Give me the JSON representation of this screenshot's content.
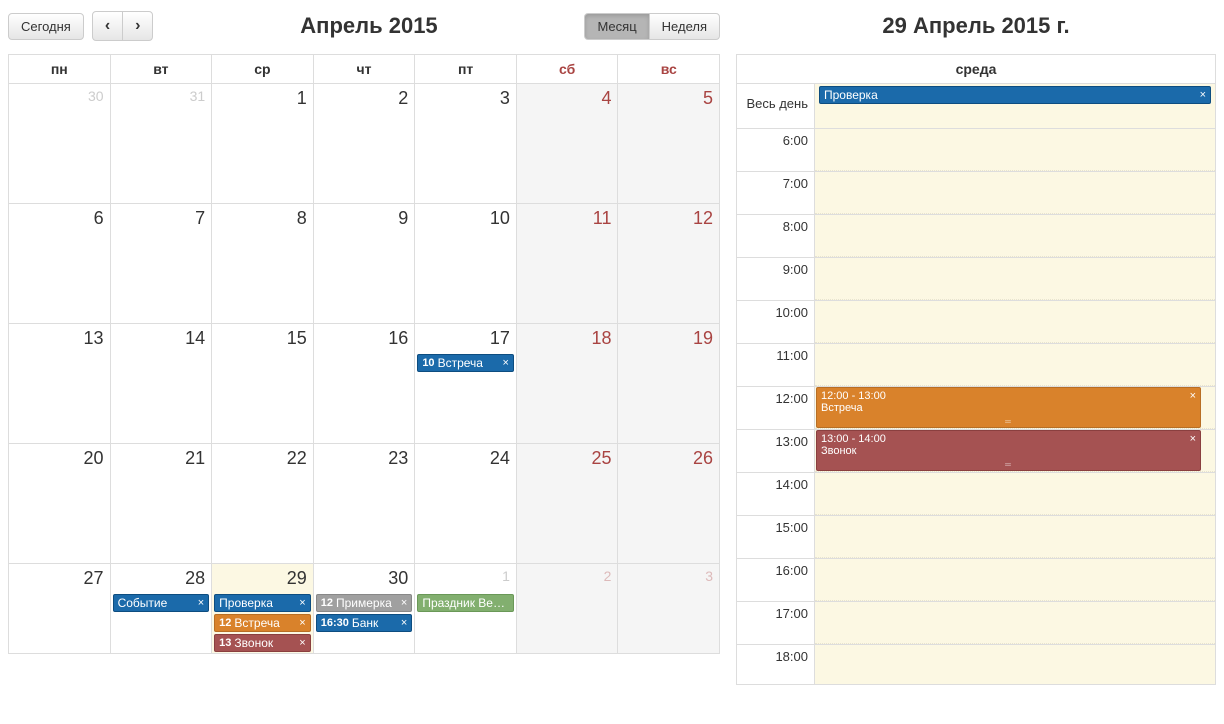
{
  "toolbar": {
    "today": "Сегодня",
    "prev_icon": "‹",
    "next_icon": "›",
    "title": "Апрель 2015",
    "view_month": "Месяц",
    "view_week": "Неделя",
    "active_view": "month"
  },
  "dow": [
    "пн",
    "вт",
    "ср",
    "чт",
    "пт",
    "сб",
    "вс"
  ],
  "weeks": [
    [
      {
        "num": "30",
        "other": true
      },
      {
        "num": "31",
        "other": true
      },
      {
        "num": "1"
      },
      {
        "num": "2"
      },
      {
        "num": "3"
      },
      {
        "num": "4",
        "weekend": true
      },
      {
        "num": "5",
        "weekend": true
      }
    ],
    [
      {
        "num": "6"
      },
      {
        "num": "7"
      },
      {
        "num": "8"
      },
      {
        "num": "9"
      },
      {
        "num": "10"
      },
      {
        "num": "11",
        "weekend": true
      },
      {
        "num": "12",
        "weekend": true
      }
    ],
    [
      {
        "num": "13"
      },
      {
        "num": "14"
      },
      {
        "num": "15"
      },
      {
        "num": "16"
      },
      {
        "num": "17",
        "events": [
          {
            "time": "10",
            "title": "Встреча",
            "cls": "blue"
          }
        ]
      },
      {
        "num": "18",
        "weekend": true
      },
      {
        "num": "19",
        "weekend": true
      }
    ],
    [
      {
        "num": "20"
      },
      {
        "num": "21"
      },
      {
        "num": "22"
      },
      {
        "num": "23"
      },
      {
        "num": "24"
      },
      {
        "num": "25",
        "weekend": true
      },
      {
        "num": "26",
        "weekend": true
      }
    ],
    [
      {
        "num": "27"
      },
      {
        "num": "28",
        "events": [
          {
            "time": "",
            "title": "Событие",
            "cls": "blue"
          }
        ]
      },
      {
        "num": "29",
        "selected": true,
        "events": [
          {
            "time": "",
            "title": "Проверка",
            "cls": "blue"
          },
          {
            "time": "12",
            "title": "Встреча",
            "cls": "orange"
          },
          {
            "time": "13",
            "title": "Звонок",
            "cls": "brown"
          }
        ]
      },
      {
        "num": "30",
        "events": [
          {
            "time": "12",
            "title": "Примерка",
            "cls": "grey"
          },
          {
            "time": "16:30",
            "title": "Банк",
            "cls": "blue"
          }
        ]
      },
      {
        "num": "1",
        "other": true,
        "events": [
          {
            "time": "",
            "title": "Праздник Весны",
            "cls": "green",
            "noclose": true
          }
        ]
      },
      {
        "num": "2",
        "other": true,
        "weekend": true
      },
      {
        "num": "3",
        "other": true,
        "weekend": true
      }
    ]
  ],
  "dayview": {
    "title": "29 Апрель 2015 г.",
    "dow_header": "среда",
    "allday_label": "Весь день",
    "allday_events": [
      {
        "title": "Проверка",
        "cls": "blue"
      }
    ],
    "hours": [
      "6:00",
      "7:00",
      "8:00",
      "9:00",
      "10:00",
      "11:00",
      "12:00",
      "13:00",
      "14:00",
      "15:00",
      "16:00",
      "17:00",
      "18:00"
    ],
    "hour_start": 6,
    "hour_height": 43,
    "timed_events": [
      {
        "start": 12,
        "end": 13,
        "range": "12:00 - 13:00",
        "title": "Встреча",
        "cls": "orange"
      },
      {
        "start": 13,
        "end": 14,
        "range": "13:00 - 14:00",
        "title": "Звонок",
        "cls": "brown"
      }
    ],
    "close_glyph": "×",
    "handle_glyph": "═"
  }
}
